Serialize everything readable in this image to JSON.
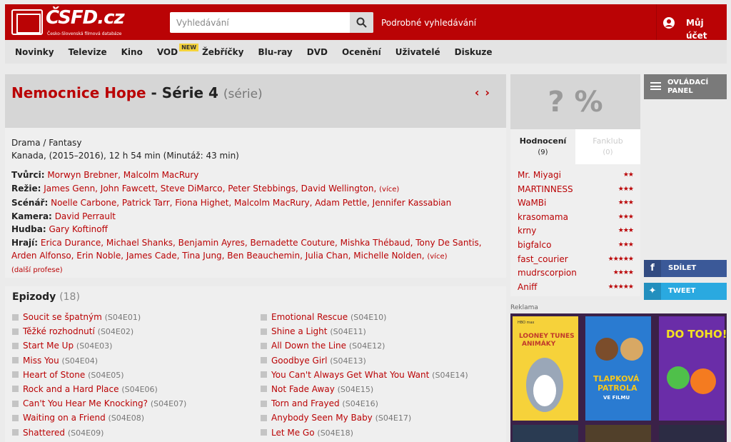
{
  "header": {
    "logo_text": "ČSFD.cz",
    "logo_sub": "Česko-Slovenská filmová databáze",
    "search_placeholder": "Vyhledávání",
    "advanced_search": "Podrobné vyhledávání",
    "account": "Můj účet"
  },
  "nav": {
    "items": [
      "Novinky",
      "Televize",
      "Kino",
      "VOD",
      "Žebříčky",
      "Blu-ray",
      "DVD",
      "Ocenění",
      "Uživatelé",
      "Diskuze"
    ],
    "vod_badge": "NEW"
  },
  "title": {
    "name": "Nemocnice Hope",
    "season": " - Série 4",
    "type": "(série)",
    "prev": "‹",
    "next": "›"
  },
  "info": {
    "genre": "Drama / Fantasy",
    "origin": "Kanada, (2015–2016), 12 h 54 min (Minutáž: 43 min)",
    "creators_label": "Tvůrci:",
    "creators": "Morwyn Brebner, Malcolm MacRury",
    "director_label": "Režie:",
    "directors": "James Genn, John Fawcett, Steve DiMarco, Peter Stebbings, David Wellington,",
    "more": "(více)",
    "script_label": "Scénář:",
    "script": "Noelle Carbone, Patrick Tarr, Fiona Highet, Malcolm MacRury, Adam Pettle, Jennifer Kassabian",
    "camera_label": "Kamera:",
    "camera": "David Perrault",
    "music_label": "Hudba:",
    "music": "Gary Koftinoff",
    "cast_label": "Hrají:",
    "cast": "Erica Durance, Michael Shanks, Benjamin Ayres, Bernadette Couture, Mishka Thébaud, Tony De Santis, Arden Alfonso, Erin Noble, James Cade, Tina Jung, Ben Beauchemin, Julia Chan, Michelle Nolden,",
    "other_professions": "(další profese)"
  },
  "episodes": {
    "heading": "Epizody",
    "count": "(18)",
    "left": [
      {
        "name": "Soucit se špatným",
        "code": "(S04E01)"
      },
      {
        "name": "Těžké rozhodnutí",
        "code": "(S04E02)"
      },
      {
        "name": "Start Me Up",
        "code": "(S04E03)"
      },
      {
        "name": "Miss You",
        "code": "(S04E04)"
      },
      {
        "name": "Heart of Stone",
        "code": "(S04E05)"
      },
      {
        "name": "Rock and a Hard Place",
        "code": "(S04E06)"
      },
      {
        "name": "Can't You Hear Me Knocking?",
        "code": "(S04E07)"
      },
      {
        "name": "Waiting on a Friend",
        "code": "(S04E08)"
      },
      {
        "name": "Shattered",
        "code": "(S04E09)"
      }
    ],
    "right": [
      {
        "name": "Emotional Rescue",
        "code": "(S04E10)"
      },
      {
        "name": "Shine a Light",
        "code": "(S04E11)"
      },
      {
        "name": "All Down the Line",
        "code": "(S04E12)"
      },
      {
        "name": "Goodbye Girl",
        "code": "(S04E13)"
      },
      {
        "name": "You Can't Always Get What You Want",
        "code": "(S04E14)"
      },
      {
        "name": "Not Fade Away",
        "code": "(S04E15)"
      },
      {
        "name": "Torn and Frayed",
        "code": "(S04E16)"
      },
      {
        "name": "Anybody Seen My Baby",
        "code": "(S04E17)"
      },
      {
        "name": "Let Me Go",
        "code": "(S04E18)"
      }
    ]
  },
  "rating": {
    "value": "? %",
    "tab_ratings": "Hodnocení",
    "tab_ratings_count": "(9)",
    "tab_fanclub": "Fanklub",
    "tab_fanclub_count": "(0)",
    "users": [
      {
        "name": "Mr. Miyagi",
        "stars": "★★"
      },
      {
        "name": "MARTINNESS",
        "stars": "★★★"
      },
      {
        "name": "WaMBi",
        "stars": "★★★"
      },
      {
        "name": "krasomama",
        "stars": "★★★"
      },
      {
        "name": "krny",
        "stars": "★★★"
      },
      {
        "name": "bigfalco",
        "stars": "★★★"
      },
      {
        "name": "fast_courier",
        "stars": "★★★★★"
      },
      {
        "name": "mudrscorpion",
        "stars": "★★★★"
      },
      {
        "name": "Aniff",
        "stars": "★★★★★"
      }
    ],
    "ad_label": "Reklama"
  },
  "side": {
    "control_panel_1": "OVLÁDACÍ",
    "control_panel_2": "PANEL",
    "share": "SDÍLET",
    "tweet": "TWEET"
  },
  "ad": {
    "poster1_title": "LOONEY TUNES ANIMÁKY",
    "poster2_title": "TLAPKOVÁ PATROLA VE FILMU",
    "poster3_title": "DO TOHO!",
    "poster1_brand": "HBO max"
  },
  "colors": {
    "brand_red": "#ba0305",
    "facebook": "#3b5998",
    "twitter": "#2aa9e0"
  }
}
